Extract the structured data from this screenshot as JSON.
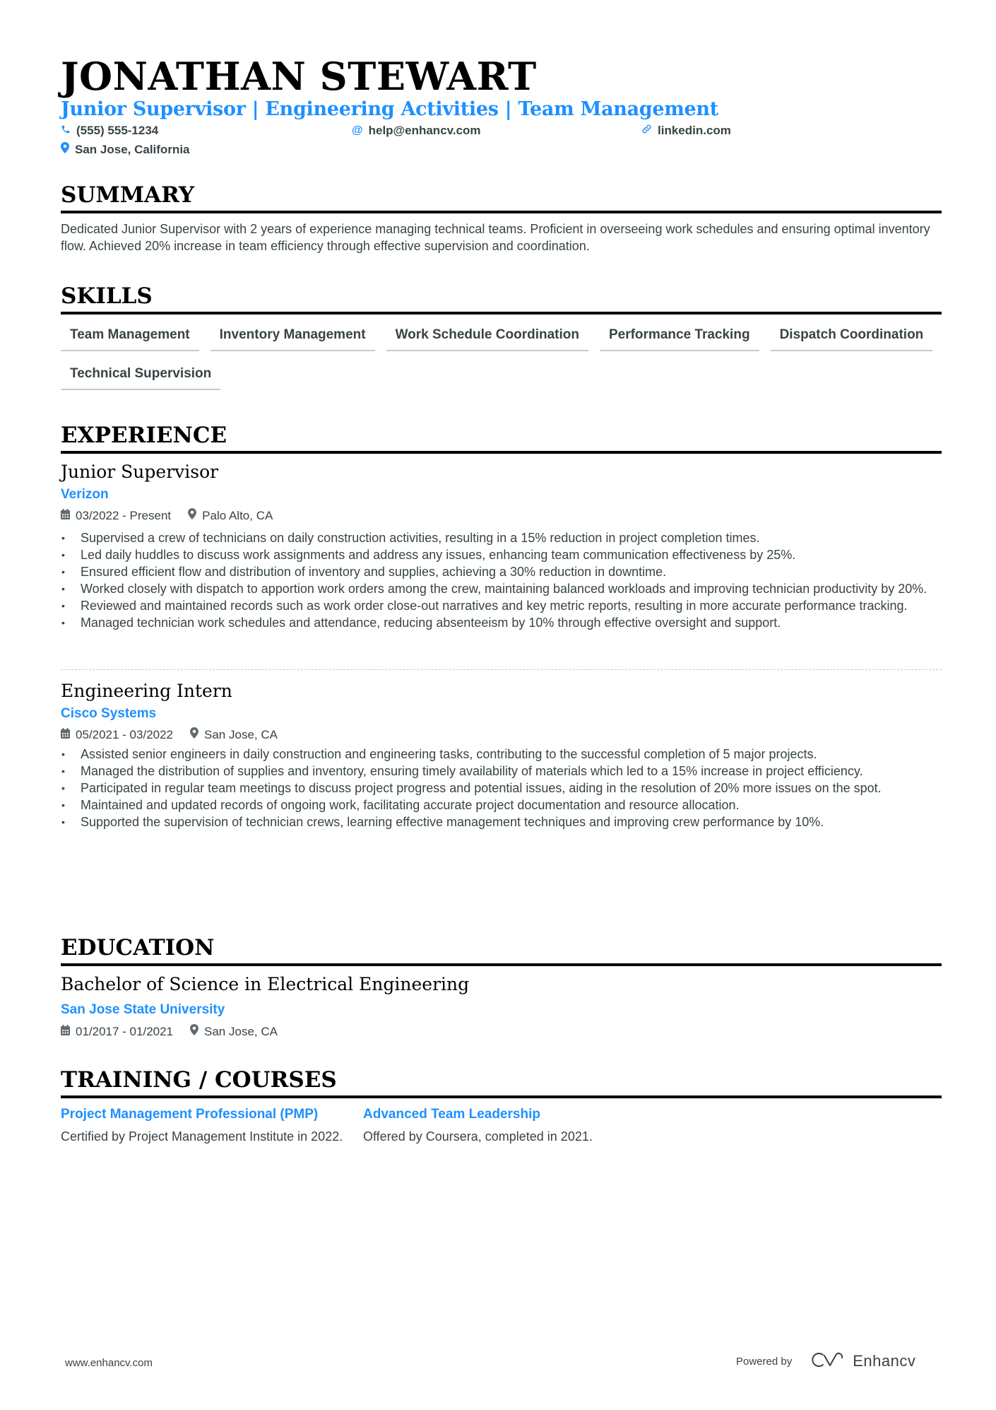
{
  "header": {
    "name": "JONATHAN STEWART",
    "headline": "Junior Supervisor | Engineering Activities | Team Management",
    "phone": "(555) 555-1234",
    "email": "help@enhancv.com",
    "website": "linkedin.com",
    "location": "San Jose, California"
  },
  "colors": {
    "accent": "#1e90ff",
    "text": "#384347",
    "heading": "#000000"
  },
  "summary": {
    "title": "SUMMARY",
    "text": "Dedicated Junior Supervisor with 2 years of experience managing technical teams. Proficient in overseeing work schedules and ensuring optimal inventory flow. Achieved 20% increase in team efficiency through effective supervision and coordination."
  },
  "skills": {
    "title": "SKILLS",
    "items": [
      "Team Management",
      "Inventory Management",
      "Work Schedule Coordination",
      "Performance Tracking",
      "Dispatch Coordination",
      "Technical Supervision"
    ]
  },
  "experience": {
    "title": "EXPERIENCE",
    "jobs": [
      {
        "role": "Junior Supervisor",
        "company": "Verizon",
        "dates": "03/2022 - Present",
        "location": "Palo Alto, CA",
        "bullets": [
          "Supervised a crew of technicians on daily construction activities, resulting in a 15% reduction in project completion times.",
          "Led daily huddles to discuss work assignments and address any issues, enhancing team communication effectiveness by 25%.",
          "Ensured efficient flow and distribution of inventory and supplies, achieving a 30% reduction in downtime.",
          "Worked closely with dispatch to apportion work orders among the crew, maintaining balanced workloads and improving technician productivity by 20%.",
          "Reviewed and maintained records such as work order close-out narratives and key metric reports, resulting in more accurate performance tracking.",
          "Managed technician work schedules and attendance, reducing absenteeism by 10% through effective oversight and support."
        ]
      },
      {
        "role": "Engineering Intern",
        "company": "Cisco Systems",
        "dates": "05/2021 - 03/2022",
        "location": "San Jose, CA",
        "bullets": [
          "Assisted senior engineers in daily construction and engineering tasks, contributing to the successful completion of 5 major projects.",
          "Managed the distribution of supplies and inventory, ensuring timely availability of materials which led to a 15% increase in project efficiency.",
          "Participated in regular team meetings to discuss project progress and potential issues, aiding in the resolution of 20% more issues on the spot.",
          "Maintained and updated records of ongoing work, facilitating accurate project documentation and resource allocation.",
          "Supported the supervision of technician crews, learning effective management techniques and improving crew performance by 10%."
        ]
      }
    ]
  },
  "education": {
    "title": "EDUCATION",
    "degree": "Bachelor of Science in Electrical Engineering",
    "school": "San Jose State University",
    "dates": "01/2017 - 01/2021",
    "location": "San Jose, CA"
  },
  "training": {
    "title": "TRAINING / COURSES",
    "courses": [
      {
        "title": "Project Management Professional (PMP)",
        "description": "Certified by Project Management Institute in 2022."
      },
      {
        "title": "Advanced Team Leadership",
        "description": "Offered by Coursera, completed in 2021."
      }
    ]
  },
  "footer": {
    "website": "www.enhancv.com",
    "powered_by": "Powered by",
    "brand": "Enhancv"
  }
}
